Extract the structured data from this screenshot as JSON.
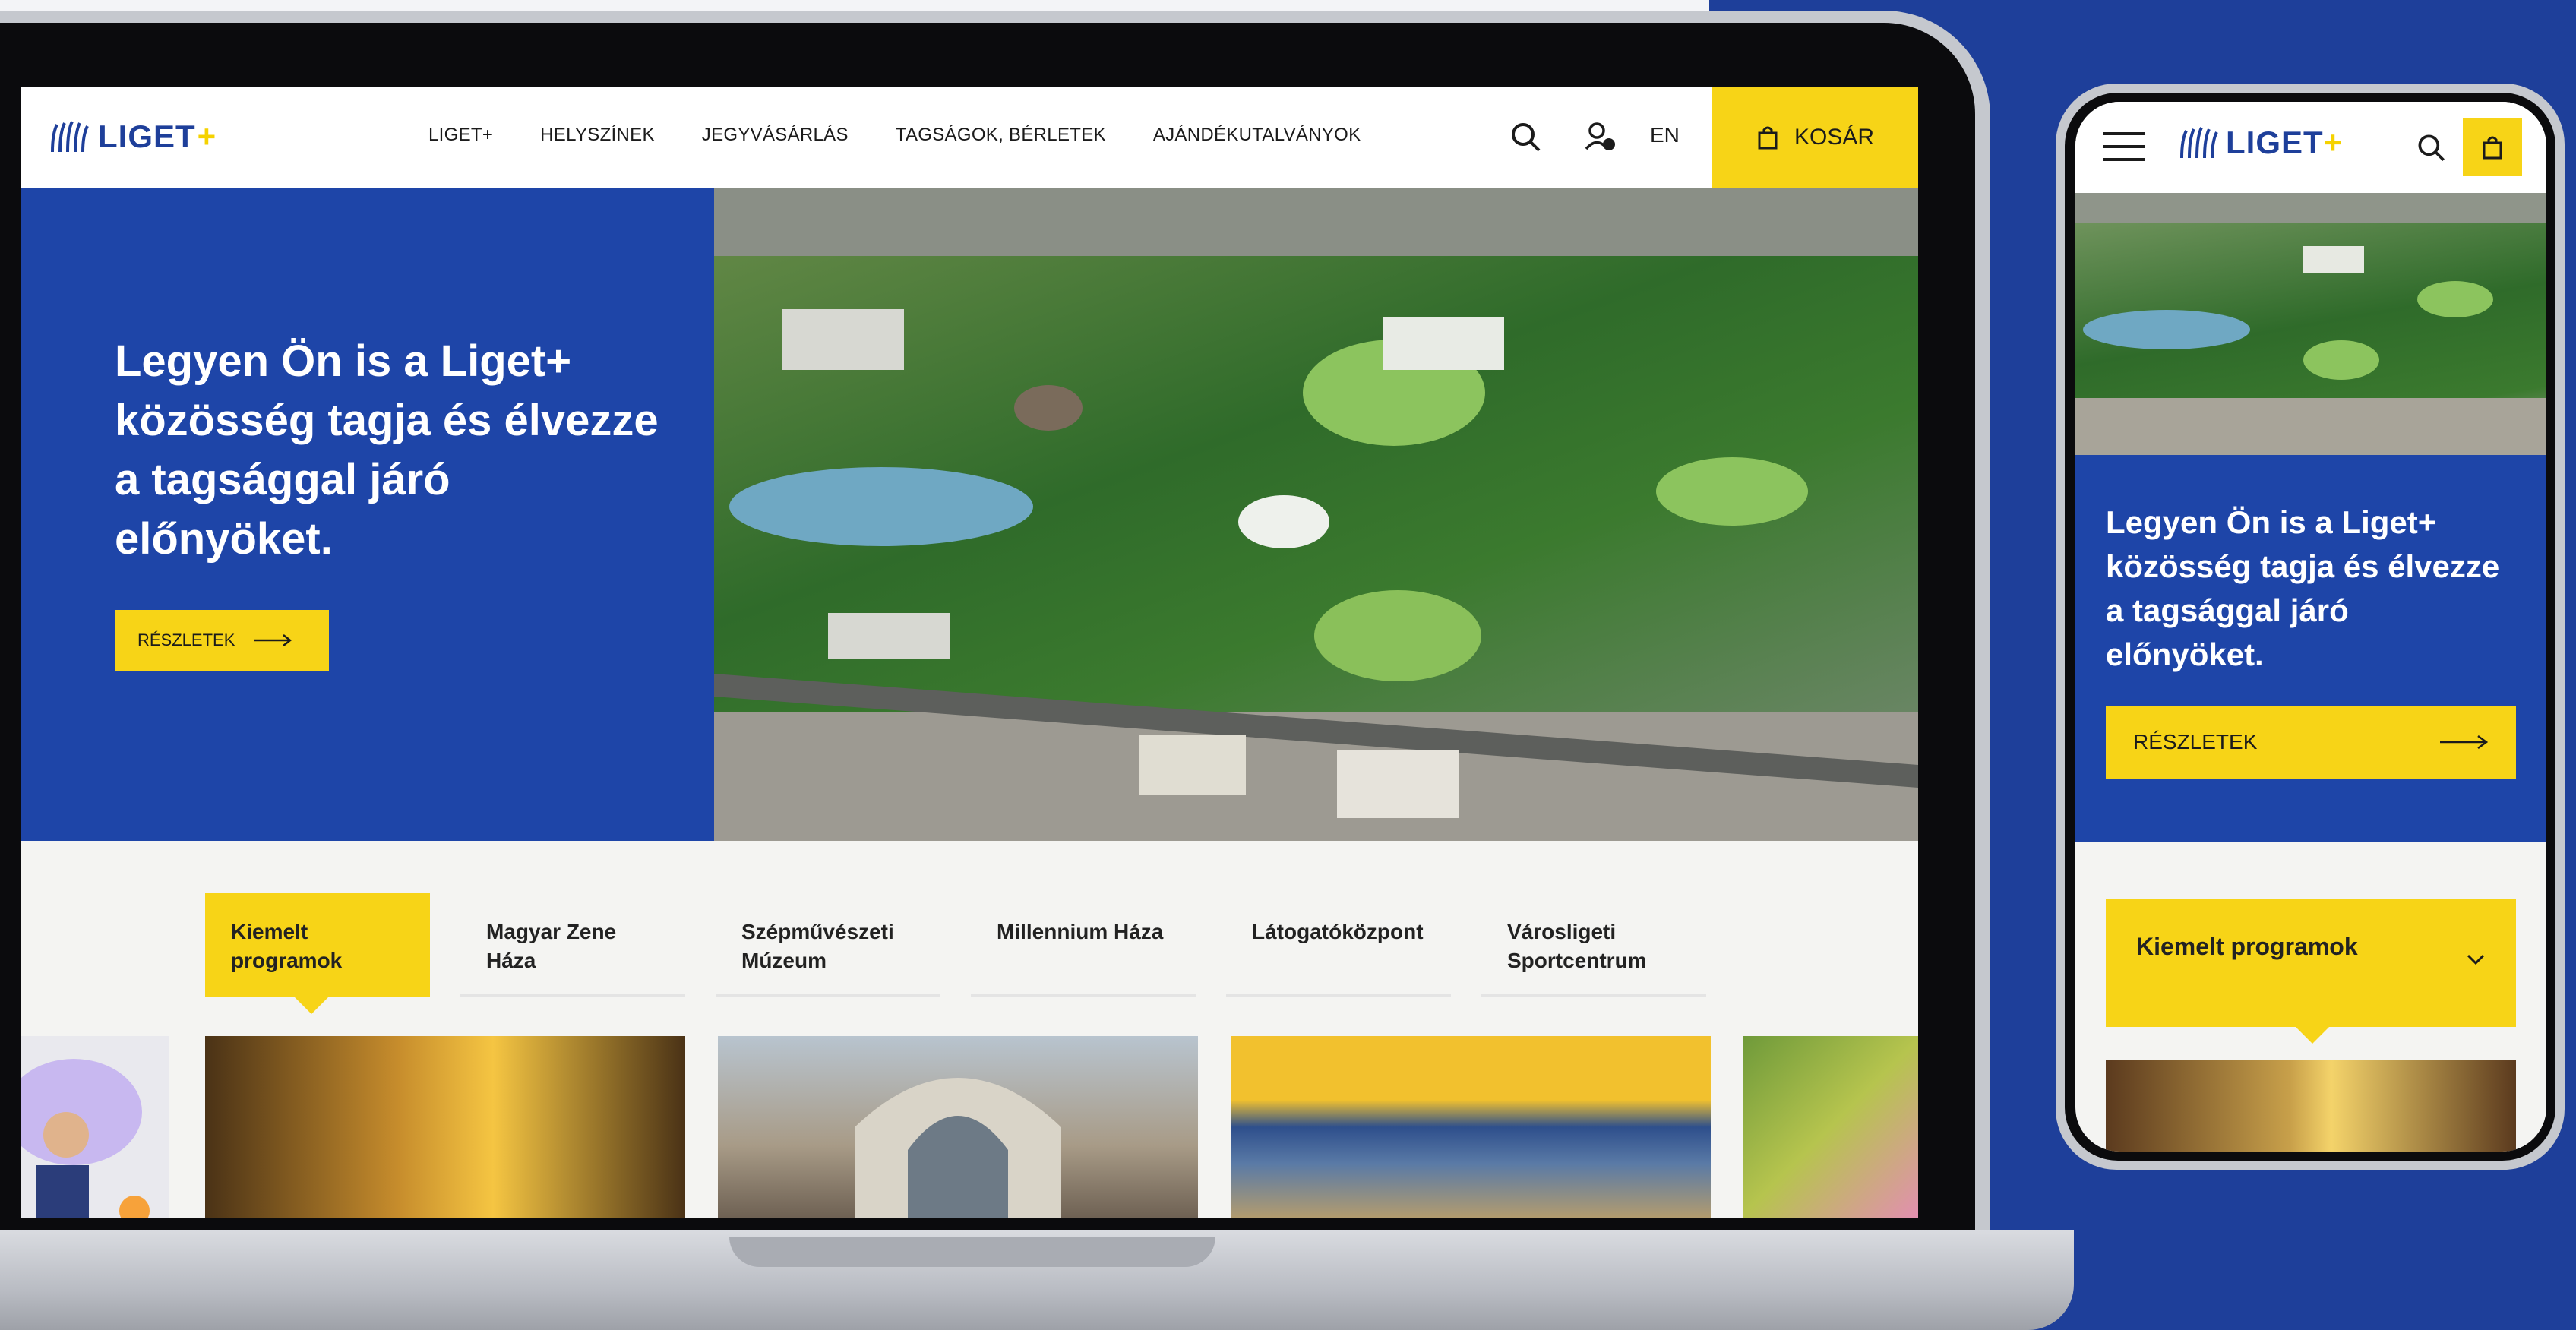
{
  "brand": {
    "logo_text": "LIGET",
    "logo_plus": "+",
    "colors": {
      "blue": "#1e45a8",
      "yellow": "#f7d417"
    }
  },
  "desktop": {
    "nav": [
      "LIGET+",
      "HELYSZÍNEK",
      "JEGYVÁSÁRLÁS",
      "TAGSÁGOK, BÉRLETEK",
      "AJÁNDÉKUTALVÁNYOK"
    ],
    "icons": {
      "search": "search-icon",
      "account": "account-icon",
      "cart": "bag-icon",
      "arrow": "arrow-right-icon"
    },
    "lang": "EN",
    "cart_label": "KOSÁR",
    "hero": {
      "title": "Legyen Ön is a Liget+ közösség tagja és élvezze a tagsággal járó előnyöket.",
      "button": "RÉSZLETEK"
    },
    "tabs": [
      "Kiemelt programok",
      "Magyar Zene Háza",
      "Szépművészeti Múzeum",
      "Millennium Háza",
      "Látogatóközpont",
      "Városligeti Sportcentrum"
    ],
    "active_tab": "Kiemelt programok"
  },
  "mobile": {
    "hero": {
      "title": "Legyen Ön is a Liget+ közösség tagja és élvezze a tagsággal járó előnyöket.",
      "button": "RÉSZLETEK"
    },
    "tab": "Kiemelt programok",
    "icons": {
      "menu": "hamburger-menu-icon",
      "search": "search-icon",
      "cart": "bag-icon",
      "expand": "chevron-down-icon",
      "arrow": "arrow-right-icon"
    }
  }
}
